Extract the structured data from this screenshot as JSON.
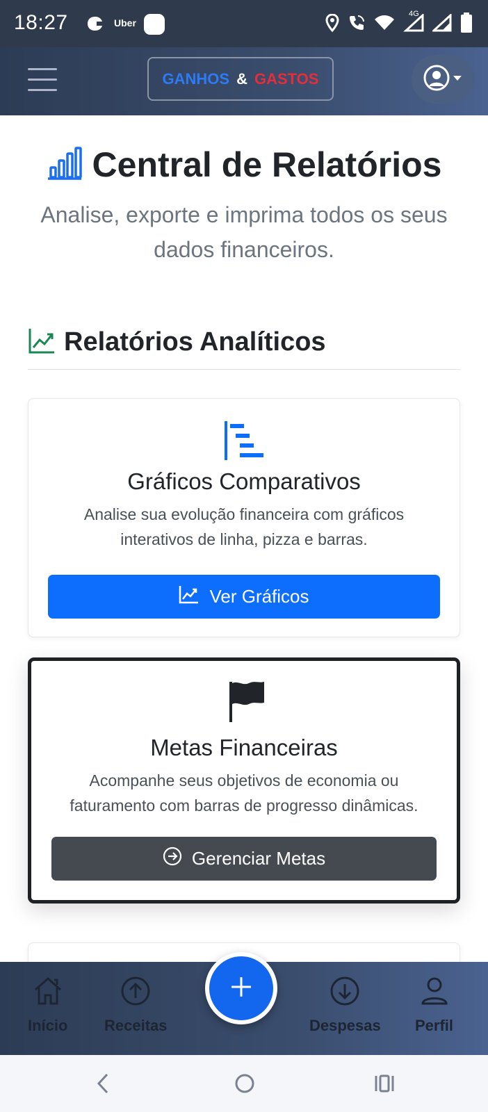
{
  "status_bar": {
    "time": "18:27",
    "app_label": "Uber",
    "network": "4G"
  },
  "header": {
    "brand_part1": "GANHOS",
    "brand_amp": "&",
    "brand_part2": "GASTOS",
    "colors": {
      "brand_blue": "#2d7bf4",
      "brand_red": "#e62d3a"
    }
  },
  "page": {
    "title": "Central de Relatórios",
    "subtitle": "Analise, exporte e imprima todos os seus dados financeiros."
  },
  "section": {
    "title": "Relatórios Analíticos",
    "icon": "line-chart-icon"
  },
  "cards": [
    {
      "icon": "bar-steps-icon",
      "title": "Gráficos Comparativos",
      "text": "Analise sua evolução financeira com gráficos interativos de linha, pizza e barras.",
      "button_label": "Ver Gráficos",
      "button_icon": "chart-line-icon",
      "button_color": "#0d6efd"
    },
    {
      "icon": "flag-icon",
      "title": "Metas Financeiras",
      "text": "Acompanhe seus objetivos de economia ou faturamento com barras de progresso dinâmicas.",
      "button_label": "Gerenciar Metas",
      "button_icon": "arrow-right-circle-icon",
      "button_color": "#444a50"
    }
  ],
  "bottom_nav": {
    "items": [
      {
        "label": "Início",
        "icon": "house-icon"
      },
      {
        "label": "Receitas",
        "icon": "arrow-up-circle-icon"
      },
      {
        "label": "Despesas",
        "icon": "arrow-down-circle-icon"
      },
      {
        "label": "Perfil",
        "icon": "person-icon"
      }
    ],
    "fab_icon": "plus-icon"
  }
}
